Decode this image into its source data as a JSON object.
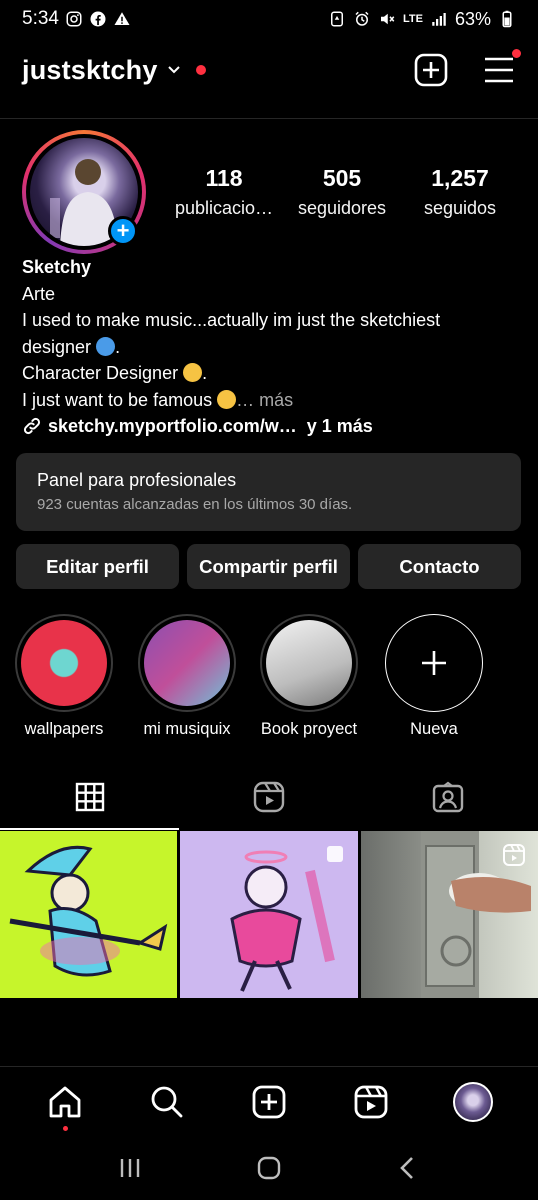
{
  "status_bar": {
    "time": "5:34",
    "network": "LTE",
    "battery": "63%"
  },
  "header": {
    "username": "justsktchy"
  },
  "profile": {
    "stats": [
      {
        "value": "118",
        "label": "publicacio…"
      },
      {
        "value": "505",
        "label": "seguidores"
      },
      {
        "value": "1,257",
        "label": "seguidos"
      }
    ],
    "name": "Sketchy",
    "category": "Arte",
    "bio_line1": "I used to make music...actually im just the sketchiest",
    "bio_line2": "designer",
    "bio_line3": "Character Designer",
    "bio_line4": "I just want to be famous",
    "bio_more": "… más",
    "link_text": "sketchy.myportfolio.com/w…",
    "link_more": "y 1 más"
  },
  "pro_panel": {
    "title": "Panel para profesionales",
    "subtitle": "923 cuentas alcanzadas en los últimos 30 días."
  },
  "buttons": {
    "edit": "Editar perfil",
    "share": "Compartir perfil",
    "contact": "Contacto"
  },
  "highlights": [
    {
      "label": "wallpapers",
      "color": "#e8334a"
    },
    {
      "label": "mi musiquix",
      "color": "#c04f9a"
    },
    {
      "label": "Book proyect",
      "color": "#dcdcdc"
    },
    {
      "label": "Nueva"
    }
  ],
  "tabs": [
    "grid-icon",
    "reels-icon",
    "tagged-icon"
  ],
  "colors": {
    "accent": "#0095f6",
    "notification": "#ff3040",
    "surface": "#262626",
    "background": "#000000"
  }
}
